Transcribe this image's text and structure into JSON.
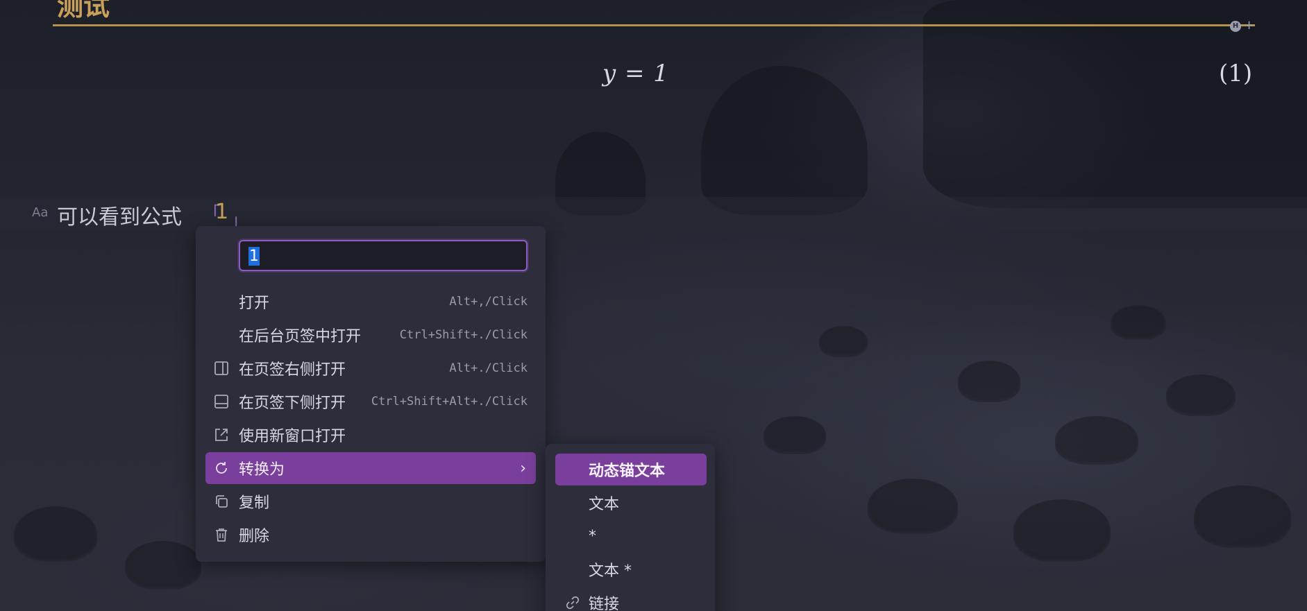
{
  "heading": {
    "title": "测试"
  },
  "equation": {
    "formula": "y = 1",
    "tag": "(1)"
  },
  "paragraph": {
    "format_icon": "Aa",
    "text": "可以看到公式",
    "anchor_open": "「",
    "anchor_value": "1",
    "anchor_close": "」"
  },
  "context_menu": {
    "rename_value": "1",
    "items": [
      {
        "label": "打开",
        "shortcut": "Alt+,/Click",
        "icon": ""
      },
      {
        "label": "在后台页签中打开",
        "shortcut": "Ctrl+Shift+./Click",
        "icon": ""
      },
      {
        "label": "在页签右侧打开",
        "shortcut": "Alt+./Click",
        "icon": "split-right-icon"
      },
      {
        "label": "在页签下侧打开",
        "shortcut": "Ctrl+Shift+Alt+./Click",
        "icon": "split-down-icon"
      },
      {
        "label": "使用新窗口打开",
        "shortcut": "",
        "icon": "external-window-icon"
      },
      {
        "label": "转换为",
        "shortcut": "",
        "icon": "refresh-icon",
        "chevron": "›"
      },
      {
        "label": "复制",
        "shortcut": "",
        "icon": "copy-icon"
      },
      {
        "label": "删除",
        "shortcut": "",
        "icon": "trash-icon"
      }
    ]
  },
  "submenu": {
    "items": [
      {
        "label": "动态锚文本"
      },
      {
        "label": "文本"
      },
      {
        "label": "*"
      },
      {
        "label": "文本 *"
      },
      {
        "label": "链接",
        "icon": "link-icon"
      }
    ]
  },
  "colors": {
    "accent_purple": "#7a3f9c",
    "heading_gold": "#c9a15a",
    "menu_bg": "#2d2d3c"
  }
}
